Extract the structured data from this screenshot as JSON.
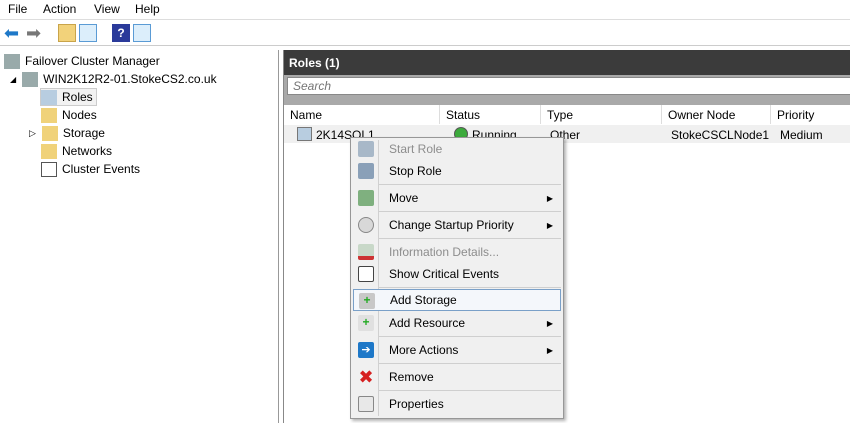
{
  "menubar": [
    "File",
    "Action",
    "View",
    "Help"
  ],
  "toolbar": {
    "icons": [
      "back-arrow-icon",
      "forward-arrow-icon",
      "up-folder-icon",
      "show-hide-console-tree-icon",
      "help-icon",
      "show-hide-action-pane-icon"
    ]
  },
  "tree": {
    "root": "Failover Cluster Manager",
    "cluster": "WIN2K12R2-01.StokeCS2.co.uk",
    "items": [
      "Roles",
      "Nodes",
      "Storage",
      "Networks",
      "Cluster Events"
    ],
    "selected": "Roles"
  },
  "pane": {
    "title": "Roles (1)",
    "search_placeholder": "Search",
    "columns": [
      "Name",
      "Status",
      "Type",
      "Owner Node",
      "Priority"
    ],
    "rows": [
      {
        "name": "2K14SQL1",
        "status": "Running",
        "type": "Other",
        "owner": "StokeCSCLNode1",
        "priority": "Medium"
      }
    ]
  },
  "context_menu": {
    "items": [
      {
        "label": "Start Role",
        "disabled": true,
        "icon": "start-role-icon"
      },
      {
        "label": "Stop Role",
        "icon": "stop-role-icon"
      },
      {
        "label": "Move",
        "submenu": true,
        "icon": "move-icon"
      },
      {
        "label": "Change Startup Priority",
        "submenu": true,
        "icon": "priority-icon"
      },
      {
        "label": "Information Details...",
        "disabled": true,
        "icon": "info-details-icon"
      },
      {
        "label": "Show Critical Events",
        "icon": "events-icon"
      },
      {
        "label": "Add Storage",
        "highlighted": true,
        "icon": "add-storage-icon"
      },
      {
        "label": "Add Resource",
        "submenu": true,
        "icon": "add-resource-icon"
      },
      {
        "label": "More Actions",
        "submenu": true,
        "icon": "more-actions-icon"
      },
      {
        "label": "Remove",
        "icon": "remove-icon"
      },
      {
        "label": "Properties",
        "icon": "properties-icon"
      }
    ]
  },
  "colors": {
    "header": "#3b3b3b",
    "highlight_border": "#7aa0c8",
    "accent": "#1e78c8"
  }
}
